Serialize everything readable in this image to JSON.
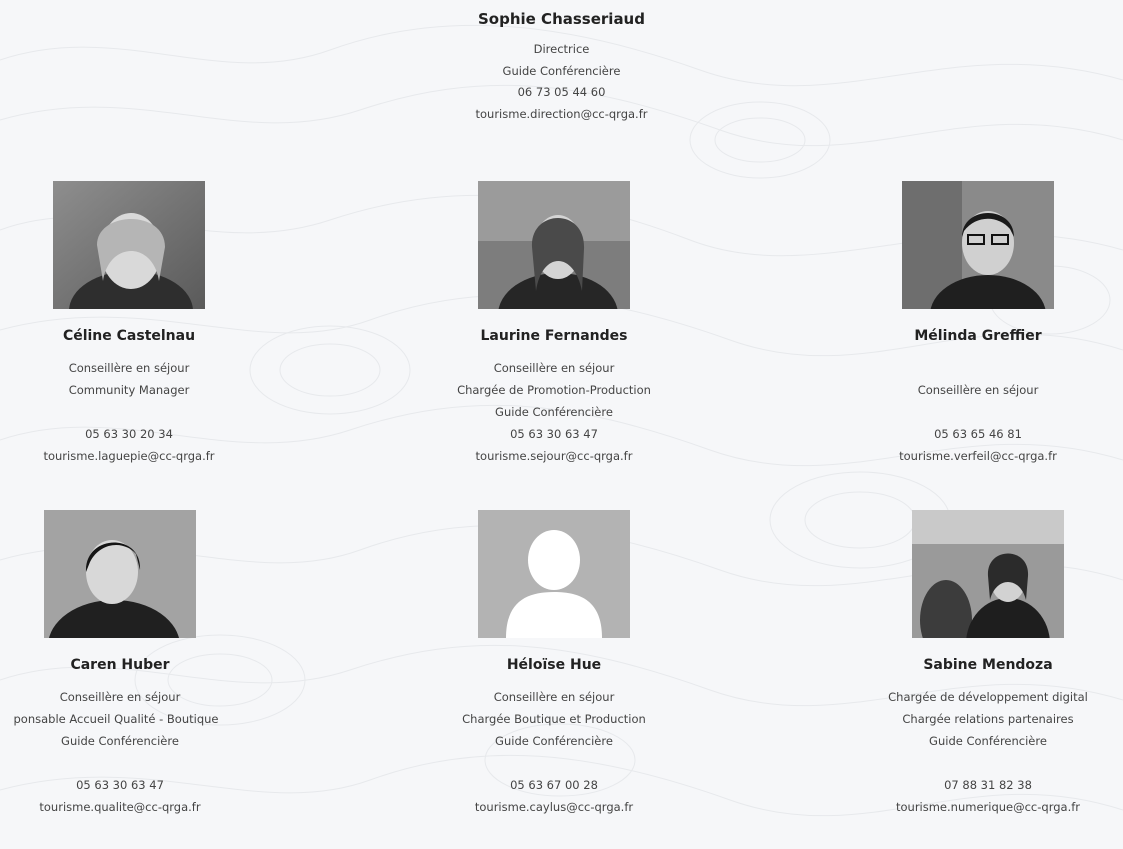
{
  "director": {
    "name": "Sophie Chasseriaud",
    "lines": [
      "Directrice",
      "Guide Conférencière",
      "06 73 05 44 60",
      "tourisme.direction@cc-qrga.fr"
    ]
  },
  "members": [
    {
      "name": "Céline Castelnau",
      "photo_icon": "portrait-photo-icon",
      "lines": [
        "Conseillère en séjour",
        "Community Manager",
        "",
        "05 63 30 20 34",
        "tourisme.laguepie@cc-qrga.fr"
      ]
    },
    {
      "name": "Laurine Fernandes",
      "photo_icon": "portrait-photo-icon",
      "lines": [
        "Conseillère en séjour",
        "Chargée de Promotion-Production",
        "Guide Conférencière",
        "05 63 30 63 47",
        "tourisme.sejour@cc-qrga.fr"
      ]
    },
    {
      "name": "Mélinda Greffier",
      "photo_icon": "portrait-photo-icon",
      "lines": [
        "",
        "Conseillère en séjour",
        "",
        "05 63 65 46 81",
        "tourisme.verfeil@cc-qrga.fr"
      ]
    },
    {
      "name": "Caren Huber",
      "photo_icon": "portrait-photo-icon",
      "lines": [
        "Conseillère en séjour",
        "ponsable Accueil Qualité - Boutique",
        "Guide Conférencière",
        "",
        "05 63 30 63 47",
        "tourisme.qualite@cc-qrga.fr"
      ]
    },
    {
      "name": "Héloïse Hue",
      "photo_icon": "avatar-placeholder-icon",
      "lines": [
        "Conseillère en séjour",
        "Chargée Boutique et Production",
        "Guide Conférencière",
        "",
        "05 63 67 00 28",
        "tourisme.caylus@cc-qrga.fr"
      ]
    },
    {
      "name": "Sabine Mendoza",
      "photo_icon": "portrait-photo-icon",
      "lines": [
        "Chargée de développement digital",
        "Chargée relations partenaires",
        "Guide Conférencière",
        "",
        "07 88 31 82 38",
        "tourisme.numerique@cc-qrga.fr"
      ]
    }
  ],
  "colors": {
    "background": "#f6f7f9",
    "placeholder_bg": "#b3b3b3",
    "placeholder_fg": "#ffffff"
  }
}
